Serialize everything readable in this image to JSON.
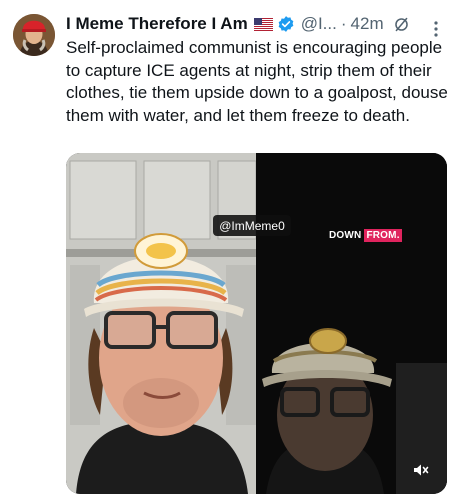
{
  "post": {
    "author_name": "I Meme Therefore I Am",
    "flag": "us-flag-icon",
    "verified": "verified-badge-icon",
    "handle": "@I...",
    "separator": "·",
    "time": "42m",
    "grok": "grok-icon",
    "more": "···",
    "text": "Self-proclaimed communist is encouraging people to capture ICE agents at night, strip them of their clothes, tie them upside down to a goalpost, douse them with water, and let them freeze to death."
  },
  "media": {
    "handle_overlay": "@ImMeme0",
    "watermark_prefix": "DOWN ",
    "watermark_highlight": "FROM.",
    "mute": "muted-speaker-icon"
  },
  "colors": {
    "text": "#0f1419",
    "secondary": "#536471",
    "verified": "#1d9bf0",
    "watermark_accent": "#e0245e"
  }
}
